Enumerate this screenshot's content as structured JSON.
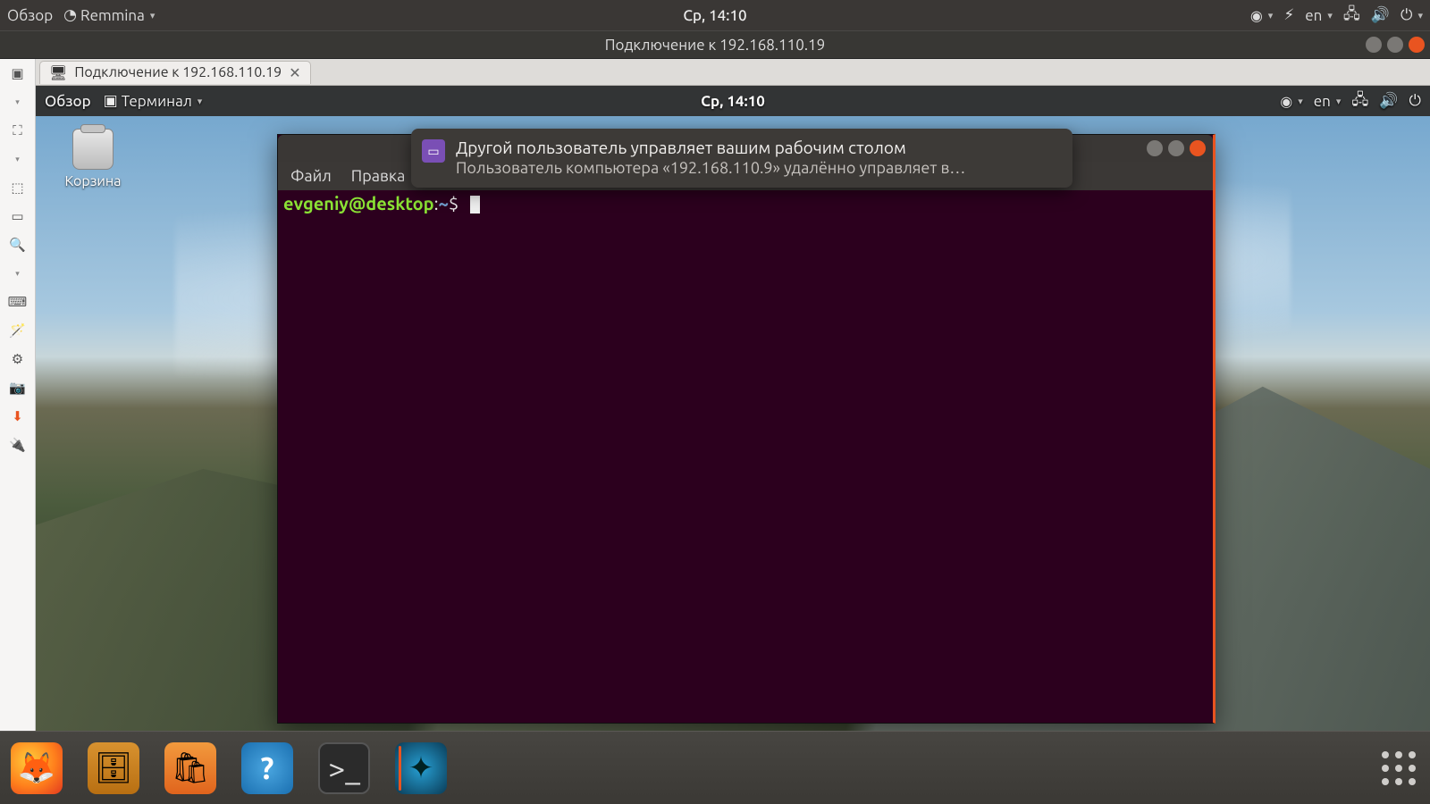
{
  "outer_topbar": {
    "activities": "Обзор",
    "app_menu": "Remmina",
    "datetime": "Ср, 14:10",
    "lang": "en"
  },
  "window": {
    "title": "Подключение к 192.168.110.19"
  },
  "tab": {
    "label": "Подключение к 192.168.110.19"
  },
  "remote_topbar": {
    "activities": "Обзор",
    "app_menu": "Терминал",
    "datetime": "Ср, 14:10",
    "lang": "en"
  },
  "desktop_icon": {
    "trash_label": "Корзина"
  },
  "terminal": {
    "menu": {
      "file": "Файл",
      "edit": "Правка"
    },
    "prompt_user": "evgeniy",
    "prompt_host": "desktop",
    "prompt_path": "~",
    "prompt_symbol": "$"
  },
  "notification": {
    "title": "Другой пользователь управляет вашим рабочим столом",
    "body": "Пользователь компьютера «192.168.110.9» удалённо управляет в…"
  }
}
